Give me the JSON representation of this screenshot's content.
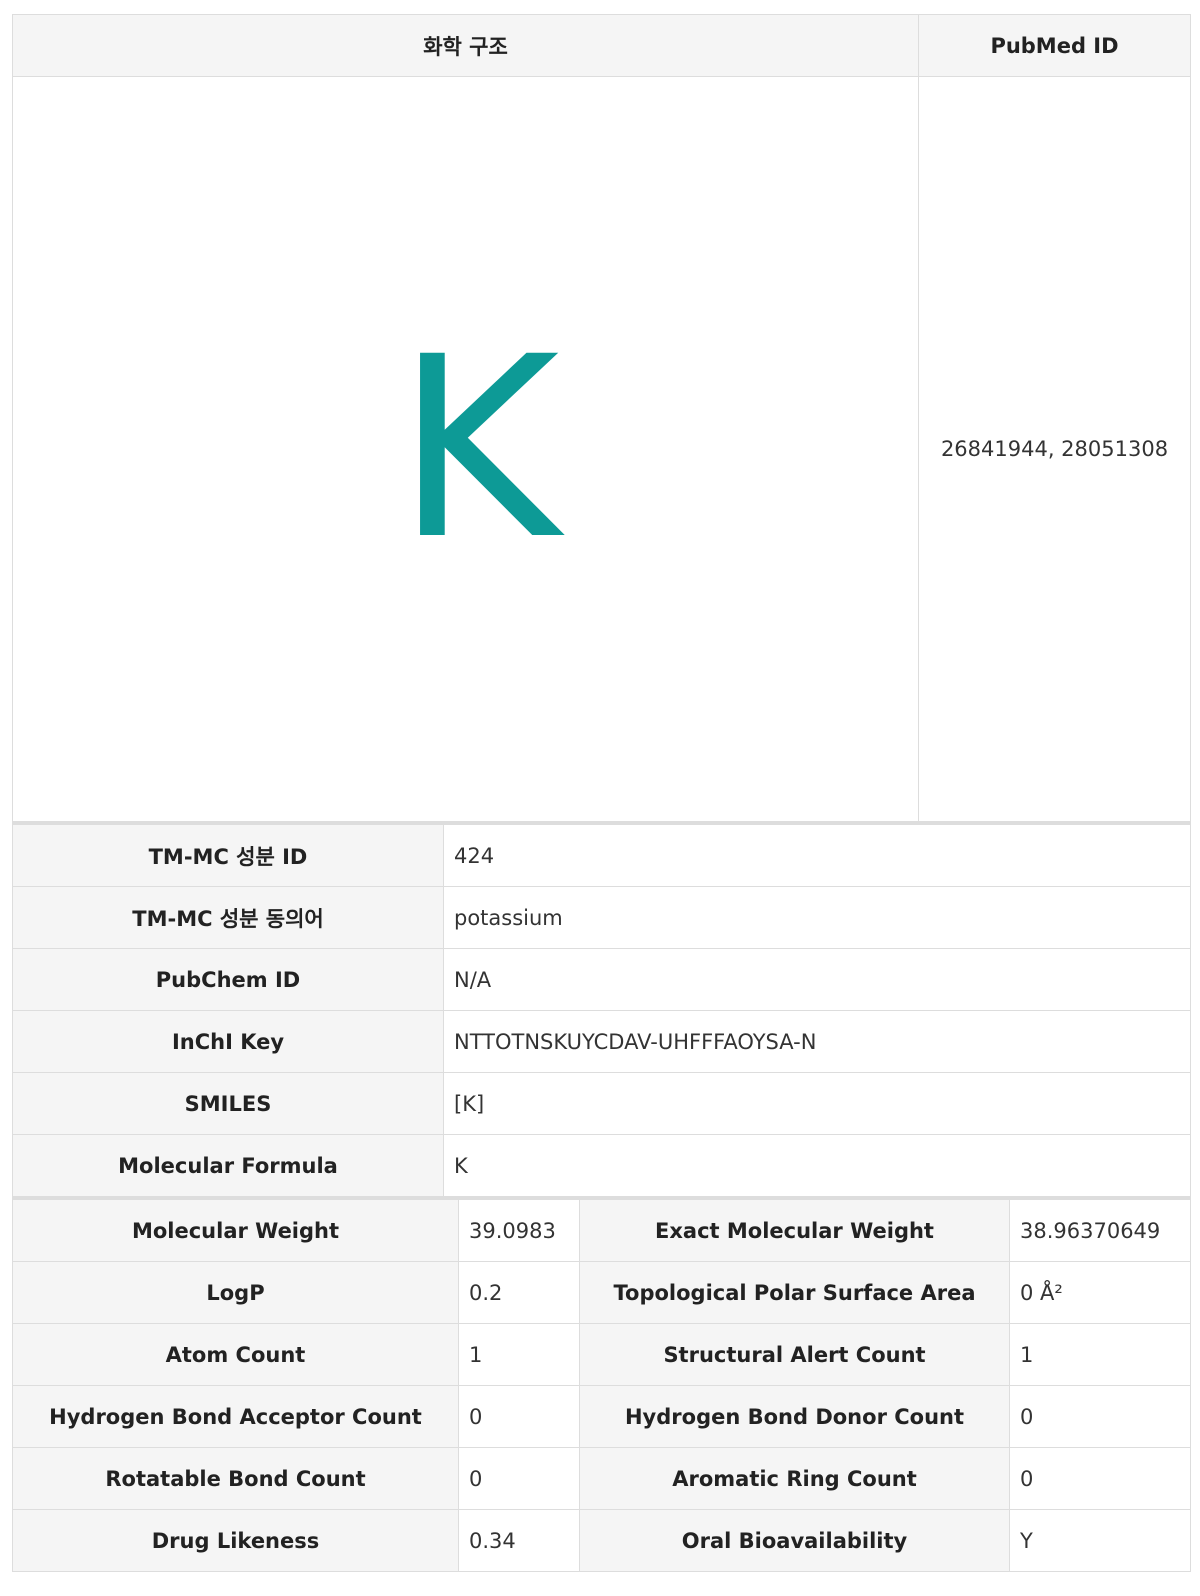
{
  "structure_table": {
    "header_structure": "화학 구조",
    "header_pubmed": "PubMed ID",
    "structure_symbol": "K",
    "pubmed_ids": "26841944, 28051308"
  },
  "info_rows": [
    {
      "label": "TM-MC 성분 ID",
      "value": "424"
    },
    {
      "label": "TM-MC 성분 동의어",
      "value": "potassium"
    },
    {
      "label": "PubChem ID",
      "value": "N/A"
    },
    {
      "label": "InChI Key",
      "value": "NTTOTNSKUYCDAV-UHFFFAOYSA-N"
    },
    {
      "label": "SMILES",
      "value": "[K]"
    },
    {
      "label": "Molecular Formula",
      "value": "K"
    }
  ],
  "property_rows": [
    {
      "label_a": "Molecular Weight",
      "value_a": "39.0983",
      "label_b": "Exact Molecular Weight",
      "value_b": "38.96370649"
    },
    {
      "label_a": "LogP",
      "value_a": "0.2",
      "label_b": "Topological Polar Surface Area",
      "value_b": "0 Å²"
    },
    {
      "label_a": "Atom Count",
      "value_a": "1",
      "label_b": "Structural Alert Count",
      "value_b": "1"
    },
    {
      "label_a": "Hydrogen Bond Acceptor Count",
      "value_a": "0",
      "label_b": "Hydrogen Bond Donor Count",
      "value_b": "0"
    },
    {
      "label_a": "Rotatable Bond Count",
      "value_a": "0",
      "label_b": "Aromatic Ring Count",
      "value_b": "0"
    },
    {
      "label_a": "Drug Likeness",
      "value_a": "0.34",
      "label_b": "Oral Bioavailability",
      "value_b": "Y"
    }
  ],
  "colors": {
    "structure_glyph": "#0d9a96",
    "header_bg": "#f5f5f5",
    "border": "#dddddd"
  }
}
